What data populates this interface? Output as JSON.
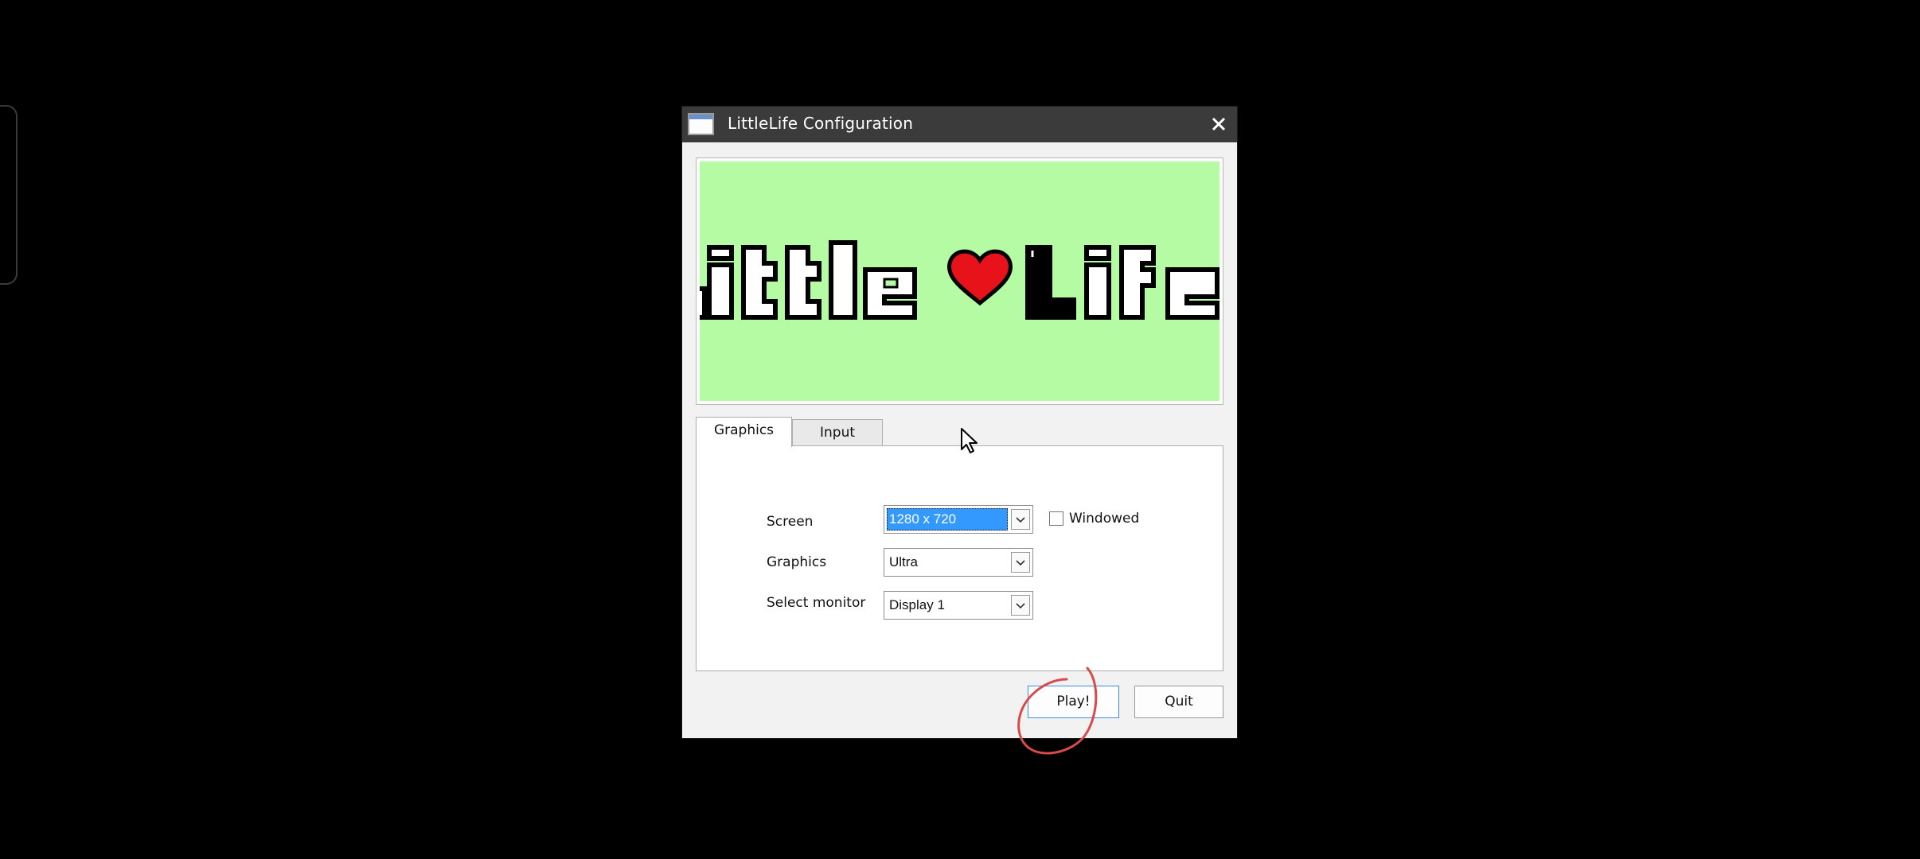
{
  "window": {
    "title": "LittleLife Configuration"
  },
  "banner": {
    "logo_text": "LittleLife",
    "background_color": "#b4fba4",
    "heart_color": "#e8121b"
  },
  "tabs": [
    {
      "label": "Graphics",
      "active": true
    },
    {
      "label": "Input",
      "active": false
    }
  ],
  "graphics": {
    "screen_label": "Screen",
    "screen_value": "1280 x 720",
    "windowed_label": "Windowed",
    "windowed_checked": false,
    "quality_label": "Graphics",
    "quality_value": "Ultra",
    "monitor_label": "Select monitor",
    "monitor_value": "Display 1"
  },
  "buttons": {
    "play": "Play!",
    "quit": "Quit"
  },
  "colors": {
    "selection": "#3399ff",
    "focus_border": "#3c8de8",
    "annotation": "#d94a4a"
  }
}
